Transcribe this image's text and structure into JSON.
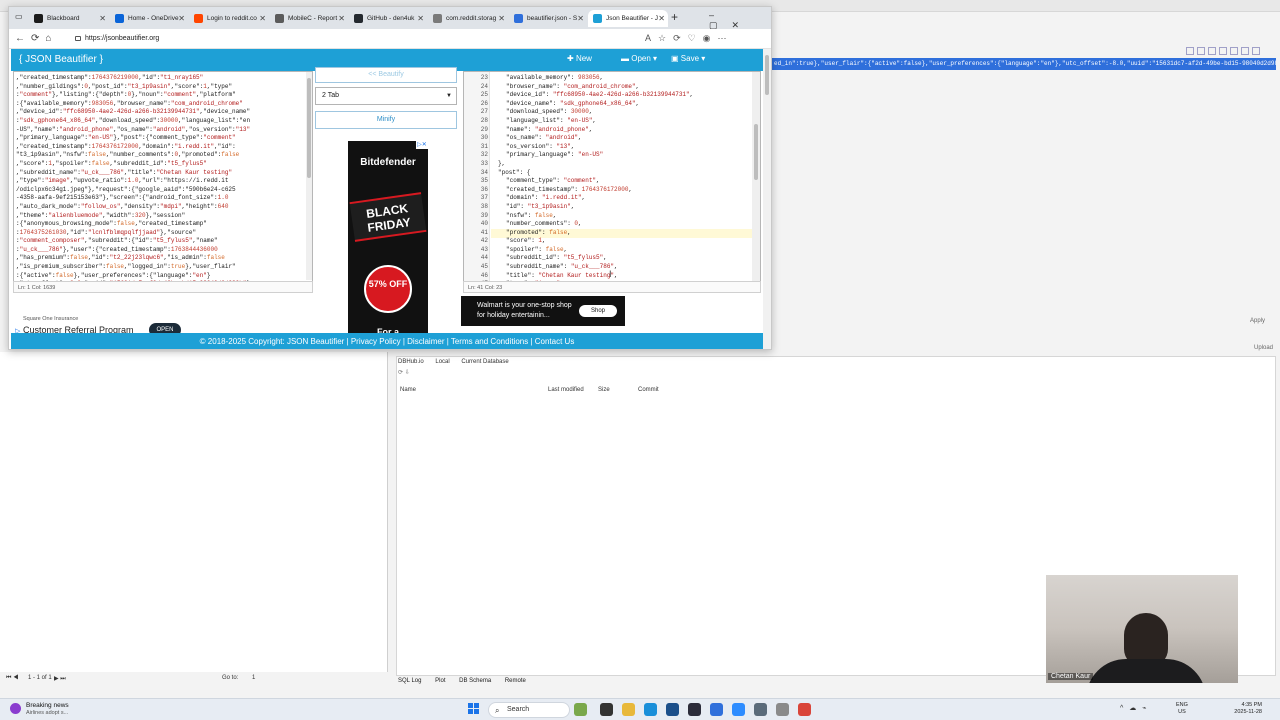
{
  "browser": {
    "tabs": [
      {
        "label": "Blackboard",
        "color": "#1b1b1b"
      },
      {
        "label": "Home - OneDrive",
        "color": "#0a64d8"
      },
      {
        "label": "Login to reddit.co",
        "color": "#ff4500"
      },
      {
        "label": "MobileC - Report",
        "color": "#5b5b5b"
      },
      {
        "label": "GitHub - den4uk",
        "color": "#24292f"
      },
      {
        "label": "com.reddit.storag",
        "color": "#7a7a7a"
      },
      {
        "label": "beautifier.json - S",
        "color": "#2f6fdb"
      },
      {
        "label": "Json Beautifier - J",
        "color": "#1ea0d6"
      }
    ],
    "url": "https://jsonbeautifier.org"
  },
  "app": {
    "title": "{ JSON Beautifier }",
    "new_label": "New",
    "open_label": "Open",
    "save_label": "Save",
    "beautify_label": "<< Beautify",
    "indent_value": "2 Tab",
    "minify_label": "Minify",
    "left_status": "Ln: 1     Col: 1639",
    "right_status": "Ln: 41     Col: 23",
    "footer": "© 2018-2025 Copyright: JSON Beautifier | Privacy Policy | Disclaimer | Terms and Conditions | Contact Us",
    "accent": "#1ea0d6"
  },
  "left_code": [
    ",\"created_timestamp\":1764376219000,\"id\":\"t1_nray165\"",
    ",\"number_gildings\":0,\"post_id\":\"t3_1p9asin\",\"score\":1,\"type\"",
    ":\"comment\"},\"listing\":{\"depth\":0},\"noun\":\"comment\",\"platform\"",
    ":{\"available_memory\":983056,\"browser_name\":\"com_android_chrome\"",
    ",\"device_id\":\"ffc68950-4ae2-426d-a266-b32139944731\",\"device_name\"",
    ":\"sdk_gphone64_x86_64\",\"download_speed\":30000,\"language_list\":\"en",
    "-US\",\"name\":\"android_phone\",\"os_name\":\"android\",\"os_version\":\"13\"",
    ",\"primary_language\":\"en-US\"},\"post\":{\"comment_type\":\"comment\"",
    ",\"created_timestamp\":1764376172000,\"domain\":\"i.redd.it\",\"id\":",
    "\"t3_1p9asin\",\"nsfw\":false,\"number_comments\":0,\"promoted\":false",
    ",\"score\":1,\"spoiler\":false,\"subreddit_id\":\"t5_fylus5\"",
    ",\"subreddit_name\":\"u_ck___786\",\"title\":\"Chetan Kaur testing\"",
    ",\"type\":\"image\",\"upvote_ratio\":1.0,\"url\":\"https://i.redd.it",
    "/odiclpx6c34g1.jpeg\"},\"request\":{\"google_aaid\":\"590b6e24-c625",
    "-4358-aafa-9ef215153e63\"},\"screen\":{\"android_font_size\":1.0",
    ",\"auto_dark_mode\":\"follow_os\",\"density\":\"mdpi\",\"height\":640",
    ",\"theme\":\"alienbluemode\",\"width\":320},\"session\"",
    ":{\"anonymous_browsing_mode\":false,\"created_timestamp\"",
    ":1764375261030,\"id\":\"lcnlfblmqpqlfjjaad\"},\"source\"",
    ":\"comment_composer\",\"subreddit\":{\"id\":\"t5_fylus5\",\"name\"",
    ":\"u_ck___786\"},\"user\":{\"created_timestamp\":1763844436000",
    ",\"has_premium\":false,\"id\":\"t2_22j23lqwc6\",\"is_admin\":false",
    ",\"is_premium_subscriber\":false,\"logged_in\":true},\"user_flair\"",
    ":{\"active\":false},\"user_preferences\":{\"language\":\"en\"}",
    ",\"utc_offset\":-8.0,\"uuid\":\"15631dc7-af2d-49be-bd15-98040d2d989b\"}"
  ],
  "right_lines": [
    "23",
    "24",
    "25",
    "26",
    "27",
    "28",
    "29",
    "30",
    "31",
    "32",
    "33",
    "34",
    "35",
    "36",
    "37",
    "38",
    "39",
    "40",
    "41",
    "42",
    "43",
    "44",
    "45",
    "46",
    "47"
  ],
  "right_code": [
    "\"available_memory\": 983056,",
    "\"browser_name\": \"com_android_chrome\",",
    "\"device_id\": \"ffc68950-4ae2-426d-a266-b32139944731\",",
    "\"device_name\": \"sdk_gphone64_x86_64\",",
    "\"download_speed\": 30000,",
    "\"language_list\": \"en-US\",",
    "\"name\": \"android_phone\",",
    "\"os_name\": \"android\",",
    "\"os_version\": \"13\",",
    "\"primary_language\": \"en-US\"",
    "},",
    "\"post\": {",
    "\"comment_type\": \"comment\",",
    "\"created_timestamp\": 1764376172000,",
    "\"domain\": \"i.redd.it\",",
    "\"id\": \"t3_1p9asin\",",
    "\"nsfw\": false,",
    "\"number_comments\": 0,",
    "\"promoted\": false,",
    "\"score\": 1,",
    "\"spoiler\": false,",
    "\"subreddit_id\": \"t5_fylus5\",",
    "\"subreddit_name\": \"u_ck___786\",",
    "\"title\": \"Chetan Kaur testing\",",
    "\"type\": \"image\","
  ],
  "ads": {
    "bitdefender_brand": "Bitdefender",
    "black_friday": "BLACK FRIDAY",
    "discount": "57% OFF",
    "fora": "For a",
    "walmart_text": "Walmart is your one-stop shop for holiday entertainin...",
    "walmart_button": "Shop",
    "sq_small": "Square One Insurance",
    "sq_main": "Customer Referral Program",
    "sq_button": "OPEN"
  },
  "background_app": {
    "selected_text": "ed_in\":true},\"user_flair\":{\"active\":false},\"user_preferences\":{\"language\":\"en\"},\"utc_offset\":-8.0,\"uuid\":\"15631dc7-af2d-49be-bd15-98040d2d989b\"}",
    "apply": "Apply",
    "upload": "Upload",
    "tabs": [
      "DBHub.io",
      "Local",
      "Current Database"
    ],
    "columns": [
      "Name",
      "Last modified",
      "Size",
      "Commit"
    ],
    "pager": "1 - 1 of 1",
    "goto_label": "Go to:",
    "goto_value": "1",
    "bottom_tabs": [
      "SQL Log",
      "Plot",
      "DB Schema",
      "Remote"
    ]
  },
  "webcam": {
    "name": "Chetan Kaur"
  },
  "taskbar": {
    "news_title": "Breaking news",
    "news_sub": "Airlines adopt s...",
    "search_placeholder": "Search",
    "lang_top": "ENG",
    "lang_bottom": "US",
    "time": "4:35 PM",
    "date": "2025-11-28"
  }
}
